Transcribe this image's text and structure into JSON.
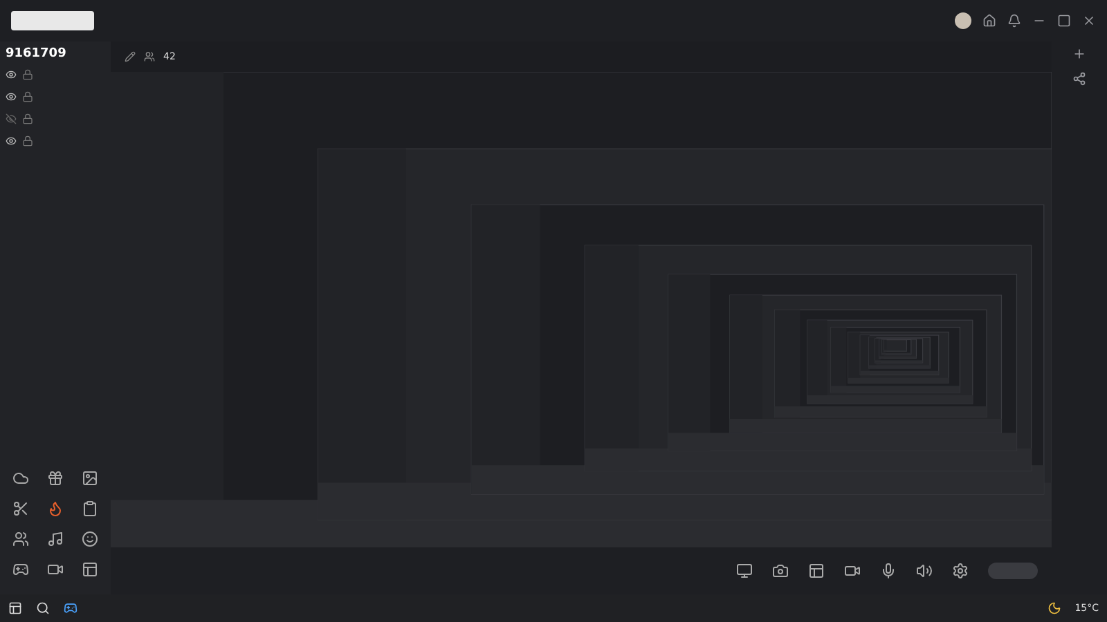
{
  "sidebar": {
    "follower_count": "9161709",
    "layers": [
      {
        "visible": true
      },
      {
        "visible": true
      },
      {
        "visible": false
      },
      {
        "visible": true
      }
    ]
  },
  "stream_info": {
    "viewers": "42"
  },
  "taskbar": {
    "weather": "15°C"
  }
}
